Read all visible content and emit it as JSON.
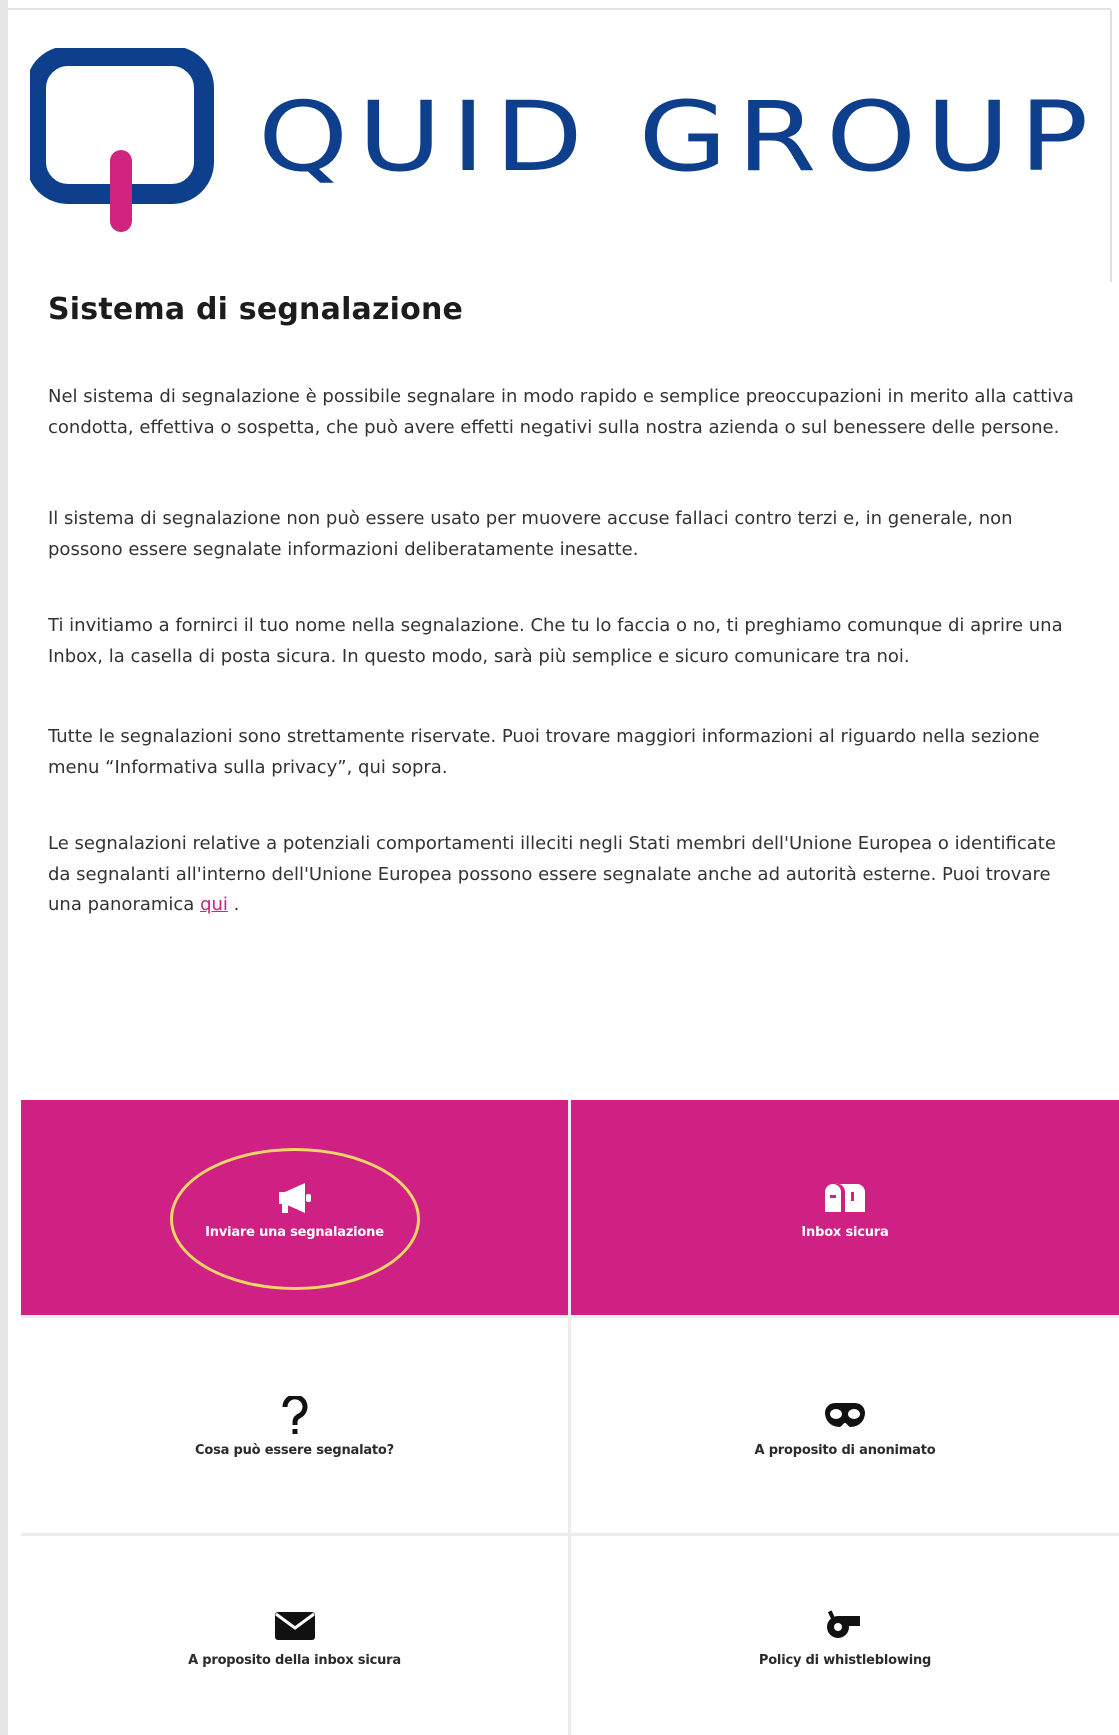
{
  "logo": {
    "brand_text": "QUID GROUP",
    "primary_color": "#0e3f8c",
    "accent_color": "#d0247f"
  },
  "page": {
    "title": "Sistema di segnalazione",
    "paragraphs": [
      "Nel sistema di segnalazione è possibile segnalare in modo rapido e semplice preoccupazioni in merito alla cattiva condotta, effettiva o sospetta, che può avere effetti negativi sulla nostra azienda o sul benessere delle persone.",
      "Il sistema di segnalazione non può essere usato per muovere accuse fallaci contro terzi e, in generale, non possono essere segnalate informazioni deliberatamente inesatte.",
      "Ti invitiamo a fornirci il tuo nome nella segnalazione. Che tu lo faccia o no, ti preghiamo comunque di aprire una Inbox, la casella di posta sicura. In questo modo, sarà più semplice e sicuro comunicare tra noi.",
      "Tutte le segnalazioni sono strettamente riservate. Puoi trovare maggiori informazioni al riguardo nella sezione menu “Informativa sulla privacy”, qui sopra."
    ],
    "last_paragraph_prefix": "Le segnalazioni relative a potenziali comportamenti illeciti negli Stati membri dell'Unione Europea o identificate da segnalanti all'interno dell'Unione Europea possono essere segnalate anche ad autorità esterne. Puoi trovare una panoramica ",
    "last_paragraph_link": "qui",
    "last_paragraph_suffix": " ."
  },
  "tiles": [
    {
      "label": "Inviare una segnalazione",
      "icon": "megaphone-icon"
    },
    {
      "label": "Inbox sicura",
      "icon": "mailbox-icon"
    },
    {
      "label": "Cosa può essere segnalato?",
      "icon": "question-mark-icon"
    },
    {
      "label": "A proposito di anonimato",
      "icon": "mask-icon"
    },
    {
      "label": "A proposito della inbox sicura",
      "icon": "envelope-icon"
    },
    {
      "label": "Policy di whistleblowing",
      "icon": "whistle-icon"
    }
  ],
  "colors": {
    "tile_pink": "#cf2083",
    "highlight_ring": "#f3d46a",
    "link": "#cf2083"
  }
}
